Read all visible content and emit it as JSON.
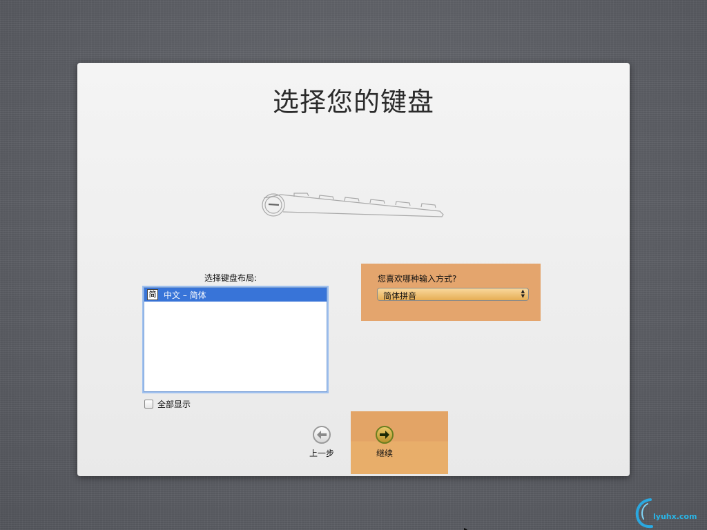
{
  "page": {
    "title": "选择您的键盘"
  },
  "layout": {
    "label": "选择键盘布局:",
    "items": [
      {
        "icon_char": "简",
        "label": "中文 – 简体",
        "selected": true
      }
    ],
    "show_all_label": "全部显示",
    "show_all_checked": false
  },
  "input_method": {
    "question": "您喜欢哪种输入方式?",
    "selected": "简体拼音"
  },
  "nav": {
    "back_label": "上一步",
    "continue_label": "继续"
  },
  "watermark": {
    "text": "lyuhx.com"
  },
  "colors": {
    "highlight_panel": "#e4a56d",
    "selection_blue": "#3874d8"
  }
}
